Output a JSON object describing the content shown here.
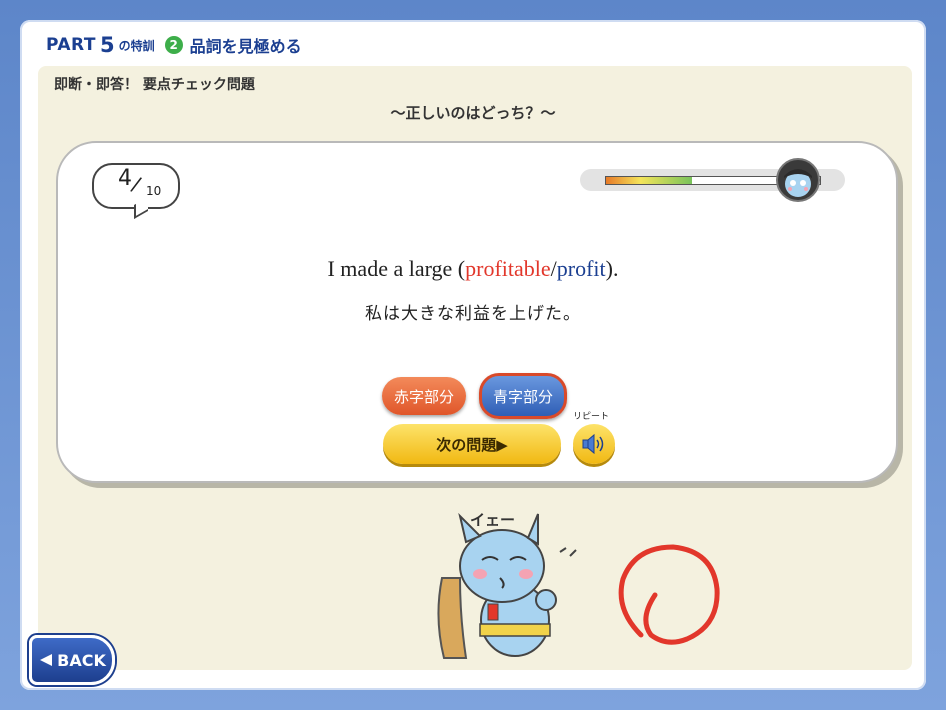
{
  "header": {
    "part_label": "PART",
    "part_number": "5",
    "part_suffix": "の特訓",
    "section_number": "2",
    "section_title": "品詞を見極める"
  },
  "subtitle": "即断・即答！ 要点チェック問題",
  "prompt": "〜正しいのはどっち？〜",
  "counter": {
    "current": "4",
    "total": "10"
  },
  "progress": {
    "value": 0.4,
    "colors": [
      "#e77a28",
      "#f4e45a",
      "#79c35b"
    ]
  },
  "question": {
    "prefix": "I made a large (",
    "option_red": "profitable",
    "separator": "/",
    "option_blue": "profit",
    "suffix": ").",
    "translation": "私は大きな利益を上げた。"
  },
  "buttons": {
    "red_label": "赤字部分",
    "blue_label": "青字部分",
    "next_label": "次の問題▶",
    "repeat_label": "リピート",
    "back_label": "BACK"
  },
  "mascot": {
    "speech": "イェー"
  },
  "icons": {
    "repeat": "speaker-icon",
    "back": "triangle-left-icon",
    "correct": "correct-circle-icon"
  },
  "colors": {
    "accent_blue": "#1b3f91",
    "accent_red": "#e2372b",
    "next_yellow": "#f1b812"
  }
}
